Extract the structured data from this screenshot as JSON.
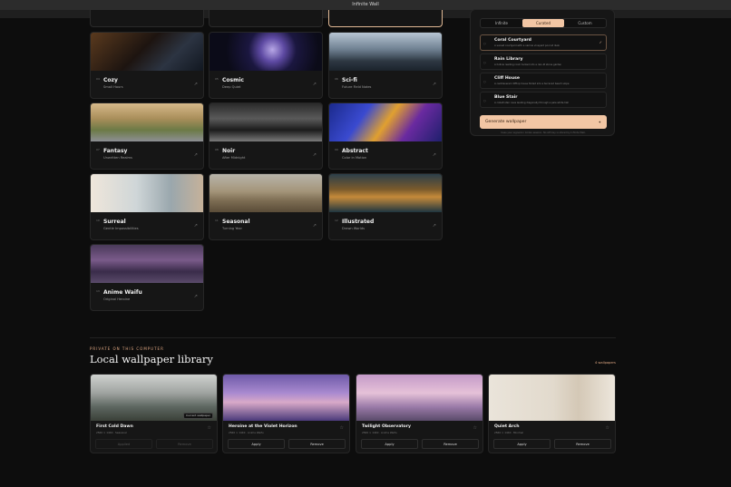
{
  "window": {
    "title": "Infinite Wall"
  },
  "gallery": {
    "cards": [
      {
        "num": "04",
        "name": "Cozy",
        "sub": "Small Hours"
      },
      {
        "num": "05",
        "name": "Cosmic",
        "sub": "Deep Quiet"
      },
      {
        "num": "06",
        "name": "Sci-fi",
        "sub": "Future Field Notes"
      },
      {
        "num": "07",
        "name": "Fantasy",
        "sub": "Unwritten Realms"
      },
      {
        "num": "08",
        "name": "Noir",
        "sub": "After Midnight"
      },
      {
        "num": "09",
        "name": "Abstract",
        "sub": "Color in Motion"
      },
      {
        "num": "10",
        "name": "Surreal",
        "sub": "Gentle Impossibilities"
      },
      {
        "num": "11",
        "name": "Seasonal",
        "sub": "Turning Year"
      },
      {
        "num": "12",
        "name": "Illustrated",
        "sub": "Drawn Worlds"
      },
      {
        "num": "13",
        "name": "Anime Waifu",
        "sub": "Original Heroine"
      }
    ],
    "arrow_glyph": "↗"
  },
  "generator": {
    "tabs": [
      "Infinite",
      "Curated",
      "Custom"
    ],
    "active_tab": "Curated",
    "options": [
      {
        "title": "Coral Courtyard",
        "desc": "A sunset courtyard with a narrow vineyard pool at dusk",
        "selected": true
      },
      {
        "title": "Rain Library",
        "desc": "A hollow reading room tucked into a rain-lit stone garden",
        "selected": false
      },
      {
        "title": "Cliff House",
        "desc": "A cantilevered clifftop house folded into a terraced beach slope",
        "selected": false
      },
      {
        "title": "Blue Stair",
        "desc": "A cobalt stair cave leading diagonally through a pale white hall",
        "selected": false
      }
    ],
    "generate_label": "Generate wallpaper",
    "footnote": "Uses your signed-in Codex session. No API key is stored by Infinite Wall."
  },
  "local": {
    "eyebrow": "PRIVATE ON THIS COMPUTER",
    "title": "Local wallpaper library",
    "count": "4 wallpapers",
    "items": [
      {
        "name": "First Cold Dawn",
        "meta": "2560 × 1440 · Seasonal",
        "badge": "Current wallpaper",
        "apply": "Applied",
        "remove": "Remove",
        "current": true
      },
      {
        "name": "Heroine at the Violet Horizon",
        "meta": "2560 × 1440 · Anime Waifu",
        "badge": "",
        "apply": "Apply",
        "remove": "Remove",
        "current": false
      },
      {
        "name": "Twilight Observatory",
        "meta": "2560 × 1440 · Anime Waifu",
        "badge": "",
        "apply": "Apply",
        "remove": "Remove",
        "current": false
      },
      {
        "name": "Quiet Arch",
        "meta": "2560 × 1440 · Minimal",
        "badge": "",
        "apply": "Apply",
        "remove": "Remove",
        "current": false
      }
    ]
  }
}
